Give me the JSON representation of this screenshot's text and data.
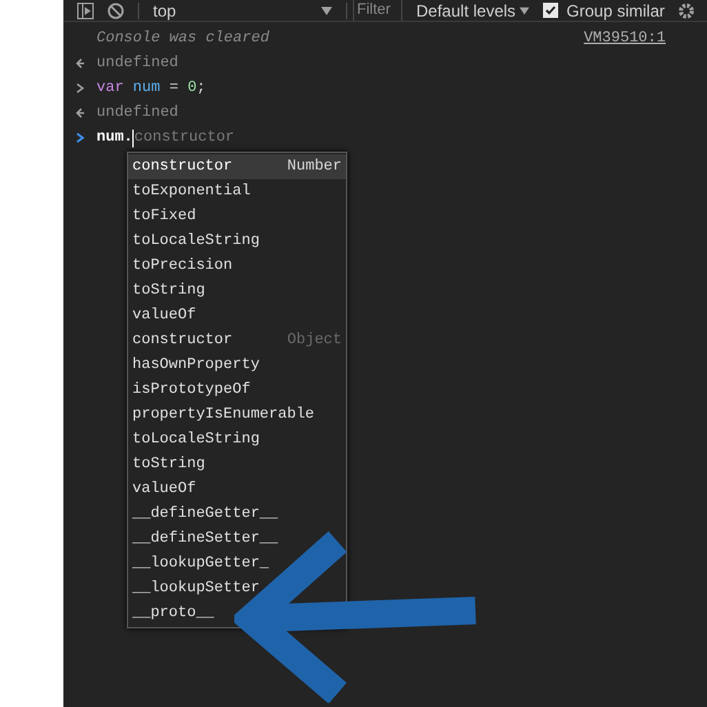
{
  "toolbar": {
    "context": "top",
    "filter_placeholder": "Filter",
    "levels": "Default levels",
    "group_similar": {
      "label": "Group similar",
      "checked": true
    }
  },
  "console": [
    {
      "kind": "info",
      "text": "Console was cleared",
      "source": "VM39510:1"
    },
    {
      "kind": "result",
      "text": "undefined"
    },
    {
      "kind": "code",
      "tokens": [
        {
          "kind": "keyword",
          "text": "var"
        },
        {
          "kind": "name",
          "text": "num"
        },
        {
          "kind": "operator",
          "text": "="
        },
        {
          "kind": "number",
          "text": "0"
        },
        {
          "kind": "punct",
          "text": ";"
        }
      ]
    },
    {
      "kind": "result",
      "text": "undefined"
    },
    {
      "kind": "prompt",
      "typed": "num.",
      "suggestion": "constructor"
    }
  ],
  "autocomplete": [
    {
      "label": "constructor",
      "hint": "Number",
      "selected": true
    },
    {
      "label": "toExponential",
      "selected": false
    },
    {
      "label": "toFixed",
      "selected": false
    },
    {
      "label": "toLocaleString",
      "selected": false
    },
    {
      "label": "toPrecision",
      "selected": false
    },
    {
      "label": "toString",
      "selected": false
    },
    {
      "label": "valueOf",
      "selected": false
    },
    {
      "label": "constructor",
      "hint": "Object",
      "selected": false
    },
    {
      "label": "hasOwnProperty",
      "selected": false
    },
    {
      "label": "isPrototypeOf",
      "selected": false
    },
    {
      "label": "propertyIsEnumerable",
      "selected": false
    },
    {
      "label": "toLocaleString",
      "selected": false
    },
    {
      "label": "toString",
      "selected": false
    },
    {
      "label": "valueOf",
      "selected": false
    },
    {
      "label": "__defineGetter__",
      "selected": false
    },
    {
      "label": "__defineSetter__",
      "selected": false
    },
    {
      "label": "__lookupGetter_",
      "selected": false
    },
    {
      "label": "__lookupSetter",
      "selected": false
    },
    {
      "label": "__proto__",
      "selected": false
    }
  ]
}
